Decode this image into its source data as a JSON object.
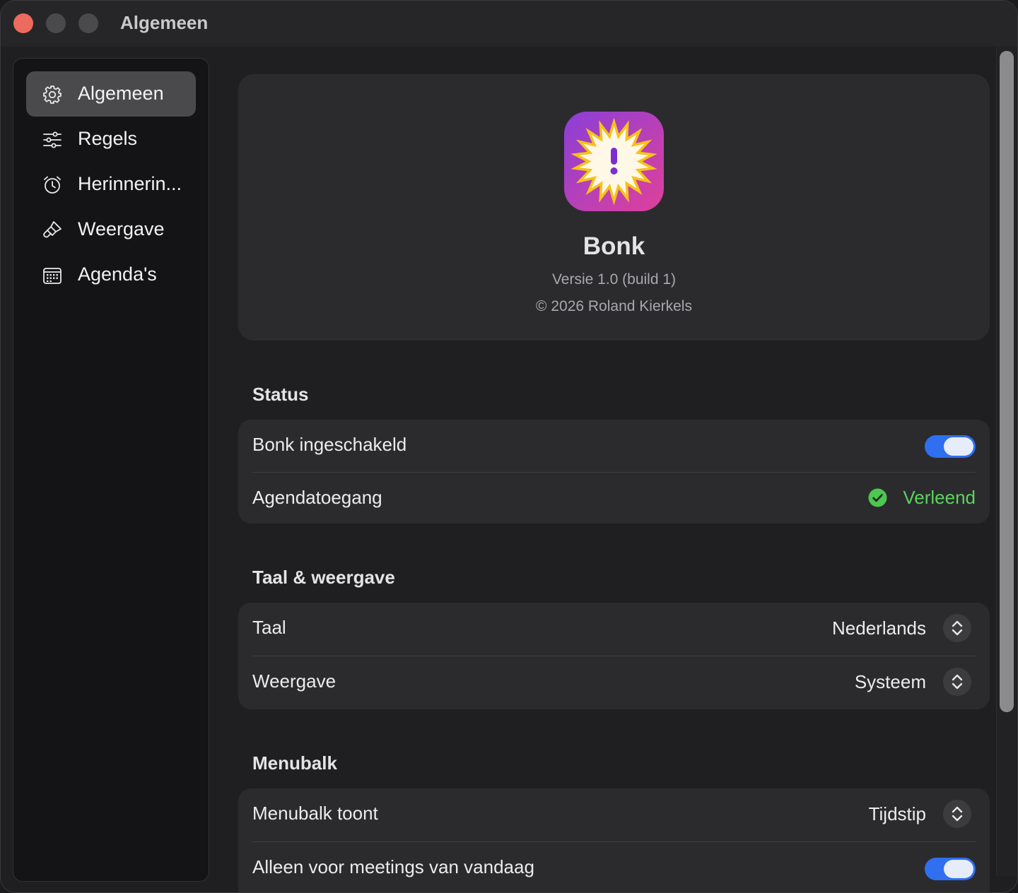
{
  "window": {
    "title": "Algemeen"
  },
  "sidebar": {
    "items": [
      {
        "label": "Algemeen",
        "icon": "gear-icon",
        "active": true
      },
      {
        "label": "Regels",
        "icon": "sliders-icon",
        "active": false
      },
      {
        "label": "Herinnerin...",
        "icon": "alarm-clock-icon",
        "active": false
      },
      {
        "label": "Weergave",
        "icon": "paintbrush-icon",
        "active": false
      },
      {
        "label": "Agenda's",
        "icon": "calendar-icon",
        "active": false
      }
    ]
  },
  "about": {
    "app_name": "Bonk",
    "version": "Versie 1.0 (build 1)",
    "copyright": "© 2026 Roland Kierkels"
  },
  "status": {
    "header": "Status",
    "enabled_label": "Bonk ingeschakeld",
    "enabled_on": true,
    "calendar_access_label": "Agendatoegang",
    "calendar_access_value": "Verleend"
  },
  "language_display": {
    "header": "Taal & weergave",
    "language_label": "Taal",
    "language_value": "Nederlands",
    "appearance_label": "Weergave",
    "appearance_value": "Systeem"
  },
  "menubar": {
    "header": "Menubalk",
    "shows_label": "Menubalk toont",
    "shows_value": "Tijdstip",
    "today_only_label": "Alleen voor meetings van vandaag",
    "today_only_on": true
  },
  "colors": {
    "accent": "#2f6ff0",
    "success": "#5bd35e",
    "close_button": "#ed6a5e"
  }
}
